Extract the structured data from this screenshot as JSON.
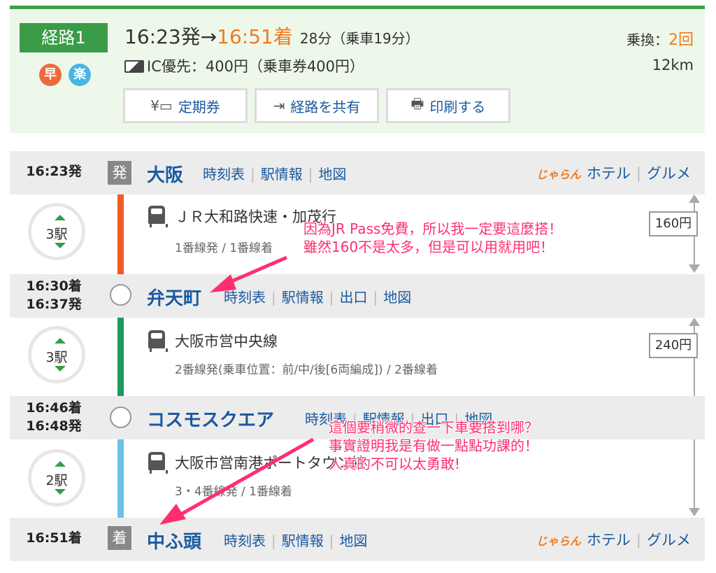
{
  "summary": {
    "route_label": "経路1",
    "tag_fast": "早",
    "tag_easy": "楽",
    "dep_time": "16:23発",
    "arrow": "→",
    "arr_time": "16:51着",
    "duration": "28分（乗車19分）",
    "transfer_label": "乗換：",
    "transfer_count": "2回",
    "fare": "IC優先：400円（乗車券400円）",
    "distance": "12km",
    "buttons": {
      "teiki": "定期券",
      "share": "経路を共有",
      "print": "印刷する"
    }
  },
  "stations": [
    {
      "time1": "16:23発",
      "time2": "",
      "mark": "発",
      "name": "大阪",
      "links": [
        "時刻表",
        "駅情報",
        "地図"
      ],
      "right_logo": "じゃらん",
      "right_links": [
        "ホテル",
        "グルメ"
      ]
    },
    {
      "time1": "16:30着",
      "time2": "16:37発",
      "name": "弁天町",
      "links": [
        "時刻表",
        "駅情報",
        "出口",
        "地図"
      ]
    },
    {
      "time1": "16:46着",
      "time2": "16:48発",
      "name": "コスモスクエア",
      "links": [
        "時刻表",
        "駅情報",
        "出口",
        "地図"
      ]
    },
    {
      "time1": "16:51着",
      "time2": "",
      "mark": "着",
      "name": "中ふ頭",
      "links": [
        "時刻表",
        "駅情報",
        "地図"
      ],
      "right_logo": "じゃらん",
      "right_links": [
        "ホテル",
        "グルメ"
      ]
    }
  ],
  "rides": [
    {
      "stops": "3駅",
      "line": "ＪＲ大和路快速・加茂行",
      "platform": "1番線発 / 1番線着",
      "fare": "160円",
      "color": "#f05a24"
    },
    {
      "stops": "3駅",
      "line": "大阪市営中央線",
      "platform": "2番線発(乗車位置：前/中/後[6両編成]) / 2番線着",
      "fare": "240円",
      "color": "#1f9a5a"
    },
    {
      "stops": "2駅",
      "line": "大阪市営南港ポートタウン線",
      "platform": "3・4番線発 / 1番線着",
      "color": "#6cc3e6"
    }
  ],
  "notes": {
    "note1": [
      "因為JR Pass免費，所以我一定要這麼搭！",
      "雖然160不是太多，但是可以用就用吧！"
    ],
    "note2": [
      "這個要稍微的查一下車要搭到哪？",
      "事實證明我是有做一點點功課的！",
      "人真的不可以太勇敢!"
    ]
  },
  "colors": {
    "accent_green": "#3a9c48",
    "link_blue": "#1a5aa0",
    "orange": "#ef7b1f",
    "annotation_pink": "#ff2f6e"
  }
}
